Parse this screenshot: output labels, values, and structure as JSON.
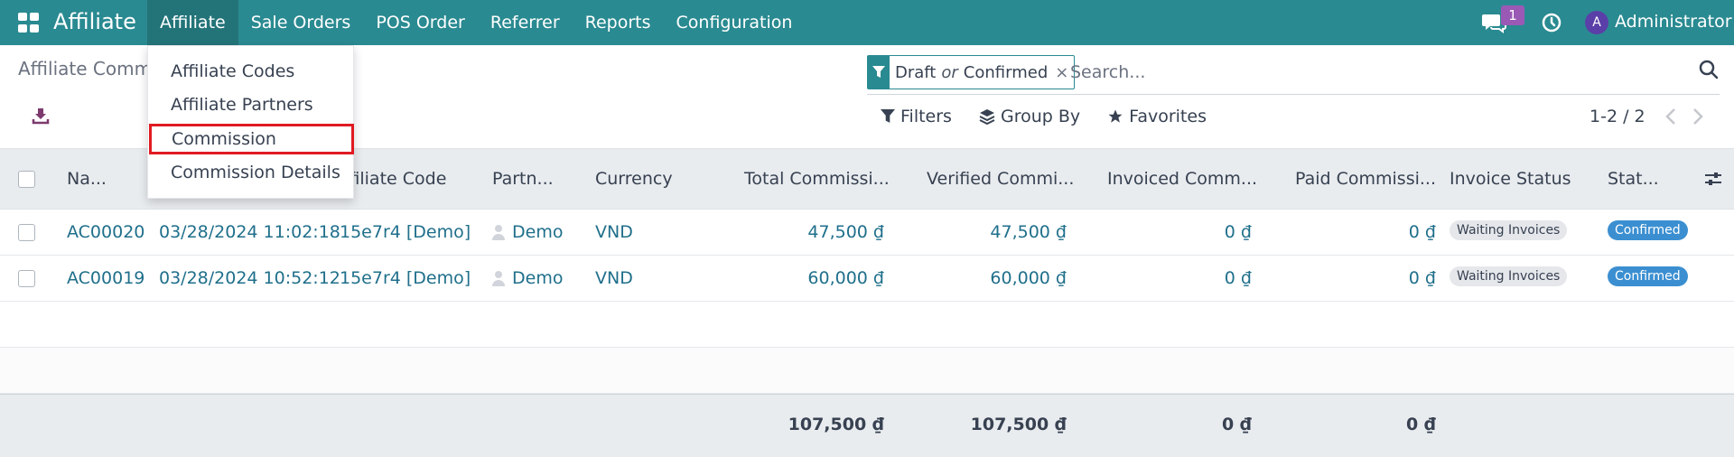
{
  "navbar": {
    "brand": "Affiliate",
    "menu": [
      "Affiliate",
      "Sale Orders",
      "POS Order",
      "Referrer",
      "Reports",
      "Configuration"
    ],
    "active_menu": "Affiliate",
    "chat_count": "1",
    "user_initial": "A",
    "user_name": "Administrator"
  },
  "dropdown": {
    "items": [
      "Affiliate Codes",
      "Affiliate Partners",
      "Commission",
      "Commission Details"
    ],
    "highlighted": "Commission"
  },
  "breadcrumb": "Affiliate Comm",
  "search": {
    "facet_first": "Draft",
    "facet_or": "or",
    "facet_second": "Confirmed",
    "facet_remove": "×",
    "placeholder": "Search..."
  },
  "search_options": {
    "filters": "Filters",
    "group_by": "Group By",
    "favorites": "Favorites"
  },
  "pager": {
    "range": "1-2 / 2"
  },
  "table": {
    "columns": [
      "Na...",
      "ffiliate Code",
      "Partn...",
      "Currency",
      "Total Commissi...",
      "Verified Commi...",
      "Invoiced Comm...",
      "Paid Commissi...",
      "Invoice Status",
      "Stat..."
    ],
    "rows": [
      {
        "name": "AC00020",
        "date": "03/28/2024 11:02:18",
        "code": "15e7r4 [Demo]",
        "partner": "Demo",
        "currency": "VND",
        "total": "47,500 ₫",
        "verified": "47,500 ₫",
        "invoiced": "0 ₫",
        "paid": "0 ₫",
        "invoice_status": "Waiting Invoices",
        "status": "Confirmed"
      },
      {
        "name": "AC00019",
        "date": "03/28/2024 10:52:12",
        "code": "15e7r4 [Demo]",
        "partner": "Demo",
        "currency": "VND",
        "total": "60,000 ₫",
        "verified": "60,000 ₫",
        "invoiced": "0 ₫",
        "paid": "0 ₫",
        "invoice_status": "Waiting Invoices",
        "status": "Confirmed"
      }
    ],
    "totals": {
      "total": "107,500 ₫",
      "verified": "107,500 ₫",
      "invoiced": "0 ₫",
      "paid": "0 ₫"
    }
  },
  "colors": {
    "navbar": "#2a8a91",
    "link": "#1f6f8b",
    "highlight_outline": "#e01b22",
    "status_badge": "#3b8fd1"
  }
}
